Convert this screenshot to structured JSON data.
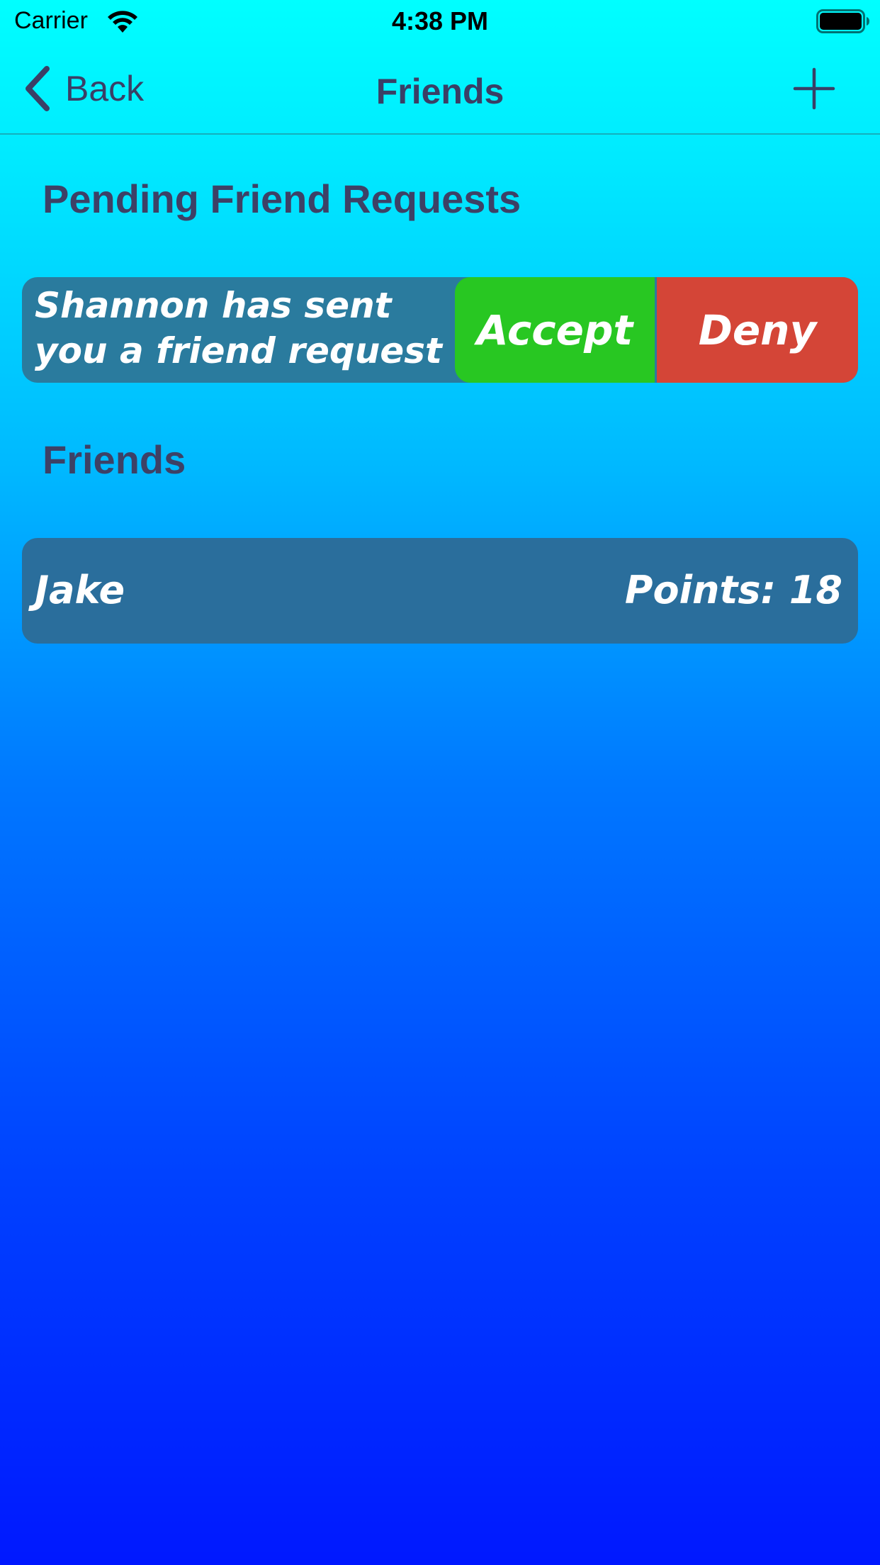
{
  "status_bar": {
    "carrier": "Carrier",
    "time": "4:38 PM",
    "wifi_icon": "wifi-icon",
    "battery_icon": "battery-icon"
  },
  "nav": {
    "back_label": "Back",
    "title": "Friends",
    "add_icon": "plus-icon"
  },
  "pending": {
    "header": "Pending Friend Requests",
    "requests": [
      {
        "message": "Shannon has sent you a friend request",
        "accept_label": "Accept",
        "deny_label": "Deny"
      }
    ]
  },
  "friends": {
    "header": "Friends",
    "items": [
      {
        "name": "Jake",
        "points_label": "Points: 18"
      }
    ]
  },
  "colors": {
    "accent_text": "#3a3f66",
    "accept": "#28c722",
    "deny": "#d44537",
    "row": "#2a7b9e",
    "gradient_top": "#00ffff",
    "gradient_bottom": "#0018ff"
  }
}
